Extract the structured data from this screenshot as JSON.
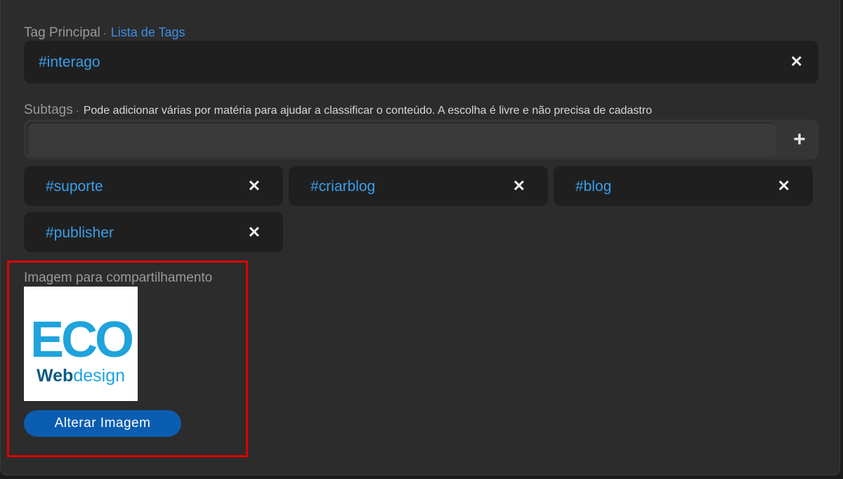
{
  "main_tag": {
    "label": "Tag Principal",
    "separator": "·",
    "list_link": "Lista de Tags",
    "value": "#interago",
    "remove_icon": "close-icon"
  },
  "subtags": {
    "label": "Subtags",
    "separator": "·",
    "hint": "Pode adicionar várias por matéria para ajudar a classificar o conteúdo. A escolha é livre e não precisa de cadastro",
    "input_value": "",
    "add_symbol": "+",
    "items": [
      {
        "label": "#suporte"
      },
      {
        "label": "#criarblog"
      },
      {
        "label": "#blog"
      },
      {
        "label": "#publisher"
      }
    ]
  },
  "share_image": {
    "label": "Imagem para compartilhamento",
    "logo_top": "ECO",
    "logo_bold": "Web",
    "logo_rest": "design",
    "button_label": "Alterar Imagem"
  },
  "colors": {
    "tag_text": "#3a9ee8",
    "link": "#3d8ee6",
    "button": "#0a5db0",
    "highlight": "#e00000",
    "logo_blue": "#1fa3dc",
    "logo_dark": "#0b5a84"
  }
}
